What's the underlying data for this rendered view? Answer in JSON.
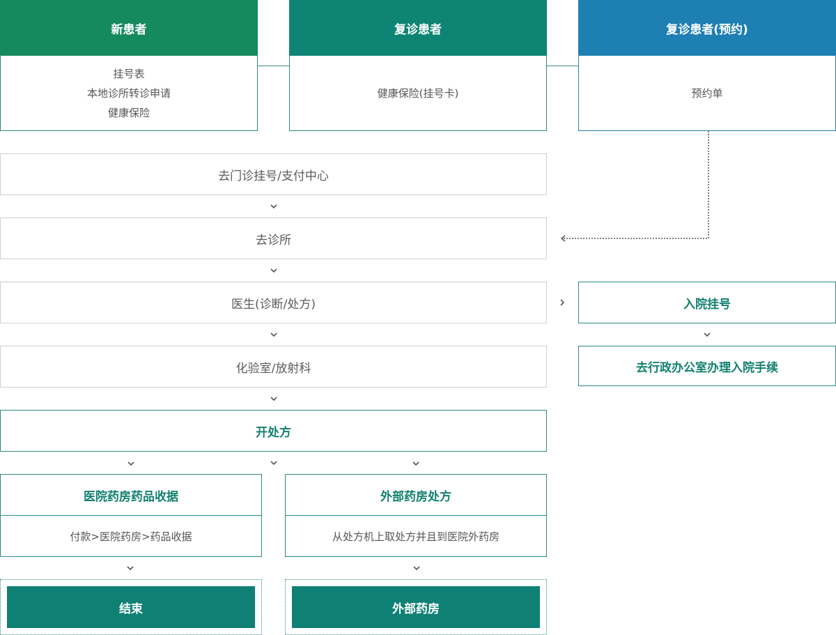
{
  "colors": {
    "new_patient_header": "#168a5f",
    "return_patient_header": "#0e8574",
    "reservation_header": "#1e7fb3",
    "accent_green": "#12806f",
    "end_box": "#0f8074"
  },
  "top_cards": {
    "new_patient": {
      "title": "新患者",
      "lines": [
        "挂号表",
        "本地诊所转诊申请",
        "健康保险"
      ]
    },
    "return_patient": {
      "title": "复诊患者",
      "lines": [
        "健康保险(挂号卡)"
      ]
    },
    "reservation_patient": {
      "title": "复诊患者(预约)",
      "lines": [
        "预约单"
      ]
    }
  },
  "steps": {
    "registration": "去门诊挂号/支付中心",
    "clinic": "去诊所",
    "doctor": "医生(诊断/处方)",
    "lab": "化验室/放射科",
    "prescription": "开处方"
  },
  "admission": {
    "register": "入院挂号",
    "office": "去行政办公室办理入院手续"
  },
  "branches": {
    "hospital_pharmacy": {
      "title": "医院药房药品收据",
      "desc": "付款>医院药房>药品收据",
      "end": "结束"
    },
    "external_pharmacy": {
      "title": "外部药房处方",
      "desc": "从处方机上取处方并且到医院外药房",
      "end": "外部药房"
    }
  }
}
